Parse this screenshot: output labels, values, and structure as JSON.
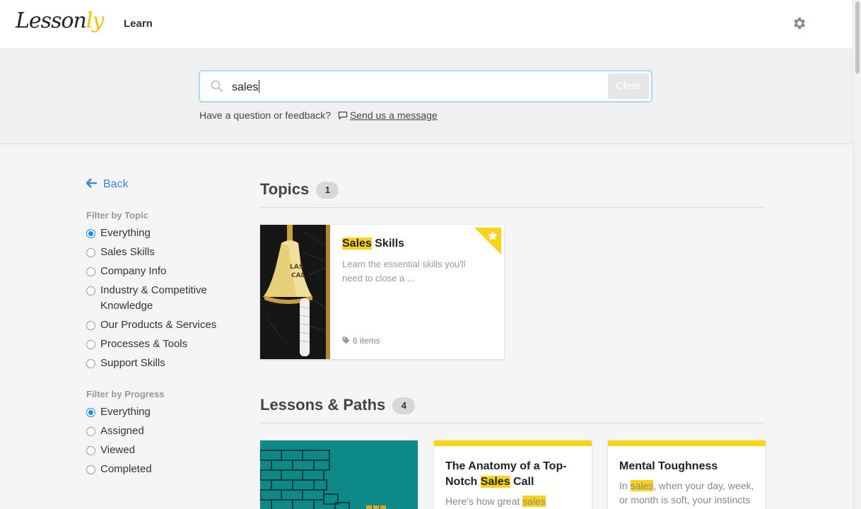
{
  "header": {
    "logo_main": "Lesson",
    "logo_accent": "ly",
    "nav_learn": "Learn",
    "settings_icon": "gear-icon"
  },
  "search": {
    "value": "sales",
    "clear_label": "Clear",
    "feedback_text": "Have a question or feedback?",
    "feedback_link": "Send us a message"
  },
  "sidebar": {
    "back_label": "Back",
    "topic_filter_title": "Filter by Topic",
    "topic_options": [
      "Everything",
      "Sales Skills",
      "Company Info",
      "Industry & Competitive",
      "Knowledge",
      "Our Products & Services",
      "Processes & Tools",
      "Support Skills"
    ],
    "progress_filter_title": "Filter by Progress",
    "progress_options": [
      "Everything",
      "Assigned",
      "Viewed",
      "Completed"
    ],
    "selected_topic": "Everything",
    "selected_progress": "Everything"
  },
  "topics": {
    "title": "Topics",
    "count": "1",
    "cards": [
      {
        "title_highlight": "Sales",
        "title_rest": " Skills",
        "description": "Learn the essential skills you'll need to close a ...",
        "items": "6 items",
        "starred": true
      }
    ]
  },
  "lessons": {
    "title": "Lessons & Paths",
    "count": "4",
    "cards": [
      {
        "type": "image"
      },
      {
        "title_pre": "The Anatomy of a Top-Notch ",
        "title_highlight": "Sales",
        "title_post": " Call",
        "desc_pre": "Here's how great ",
        "desc_highlight": "sales",
        "desc_post": ""
      },
      {
        "title_pre": "Mental Toughness",
        "desc_pre": "In ",
        "desc_highlight": "sales",
        "desc_post": ", when your day, week, or month is soft, your instincts"
      }
    ]
  },
  "colors": {
    "accent_blue": "#1a8cf0",
    "highlight_yellow": "#f7d417",
    "link_blue": "#3a85d8"
  }
}
